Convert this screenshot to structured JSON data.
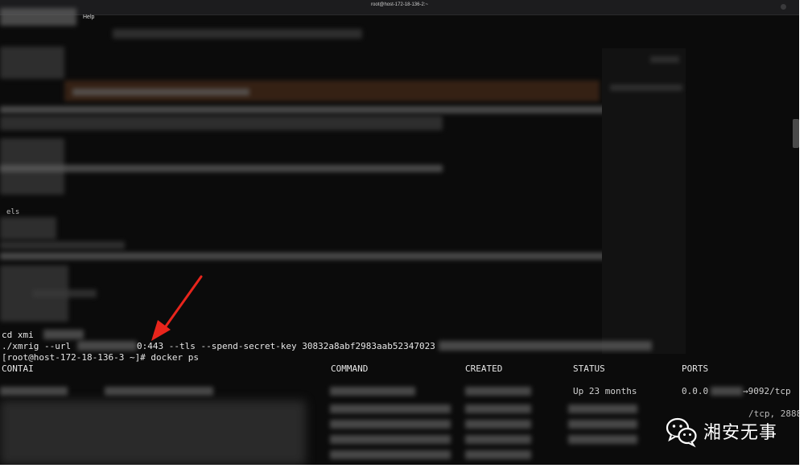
{
  "window": {
    "title": "root@host-172-18-136-2:~",
    "menu_help": "Help"
  },
  "terminal": {
    "partial_label": "els",
    "lines": {
      "cd": "cd xmi",
      "xmrig_start": "./xmrig --url",
      "xmrig_mid": "0:443 --tls --spend-secret-key 30832a8abf2983aab52347023",
      "prompt": "[root@host-172-18-136-3 ~]# docker ps"
    }
  },
  "docker_ps": {
    "headers": {
      "container": "CONTAI",
      "command": "COMMAND",
      "created": "CREATED",
      "status": "STATUS",
      "ports": "PORTS"
    },
    "row1": {
      "status": "Up 23 months",
      "ports_start": "0.0.0",
      "ports_end": "→9092/tcp"
    },
    "row2": {
      "ports_fragment": "/tcp, 2888"
    }
  },
  "watermark": {
    "icon": "wechat-icon",
    "text": "湘安无事"
  },
  "colors": {
    "terminal_bg": "#0b0b0b",
    "text": "#e6e6e6",
    "arrow": "#e8251c"
  }
}
